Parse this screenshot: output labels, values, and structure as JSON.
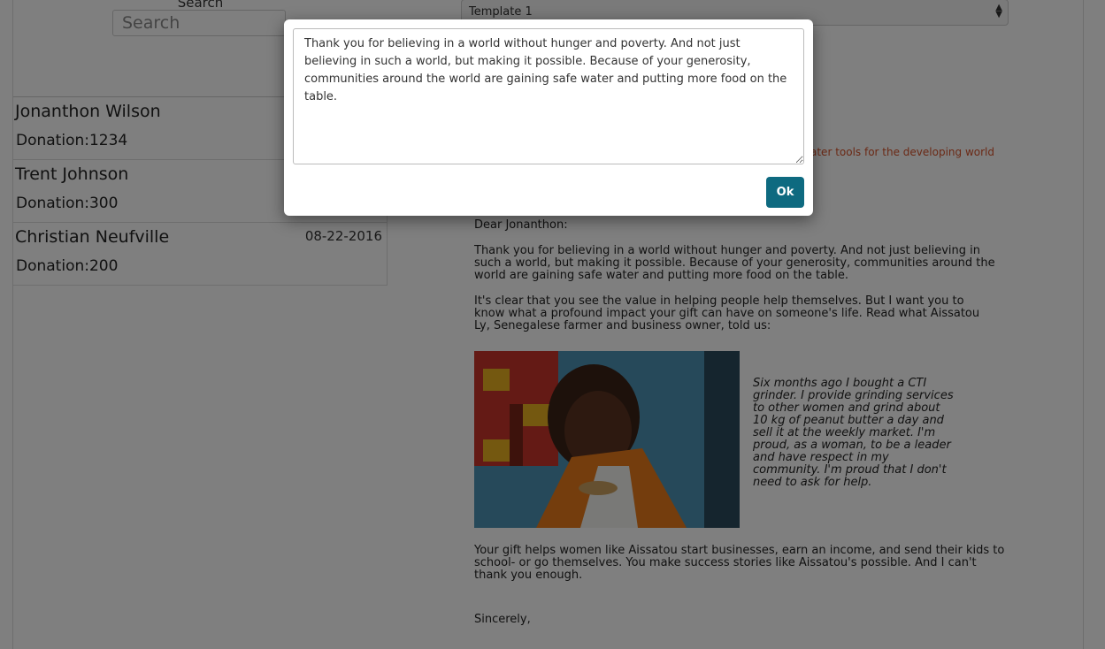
{
  "search": {
    "label": "Search",
    "placeholder": "Search"
  },
  "donors": [
    {
      "name": "Jonanthon Wilson",
      "amount": "Donation:1234",
      "date": ""
    },
    {
      "name": "Trent Johnson",
      "amount": "Donation:300",
      "date": ""
    },
    {
      "name": "Christian Neufville",
      "amount": "Donation:200",
      "date": "08-22-2016"
    }
  ],
  "template": {
    "selected": "Template 1"
  },
  "tagline_fragment": "ater tools for the developing world",
  "letter": {
    "salutation": "Dear Jonanthon:",
    "para1": "Thank you for believing in a world without hunger and poverty. And not just believing in such a world, but making it possible. Because of your generosity, communities around the world are gaining safe water and putting more food on the table.",
    "para2": "It's clear that you see the value in helping people help themselves. But I want you to know what a profound impact your gift can have on someone's life. Read what Aissatou Ly, Senegalese farmer and business owner, told us:",
    "quote": "Six months ago I bought a CTI grinder. I provide grinding services to other women and grind about 10 kg of peanut butter a day and sell it at the weekly market. I'm proud, as a woman, to be a leader and have respect in my community. I'm proud that I don't need to ask for help.",
    "para3": "Your gift helps women like Aissatou start businesses, earn an income, and send their kids to school- or go themselves. You make success stories like Aissatou's possible. And I can't thank you enough.",
    "closing": "Sincerely,"
  },
  "modal": {
    "text": "Thank you for believing in a world without hunger and poverty. And not just believing in such a world, but making it possible. Because of your generosity, communities around the world are gaining safe water and putting more food on the table.",
    "ok_label": "Ok"
  },
  "colors": {
    "accent": "#0e6a80",
    "tagline": "#d6522a",
    "overlay": "rgba(0,0,0,0.5)"
  }
}
